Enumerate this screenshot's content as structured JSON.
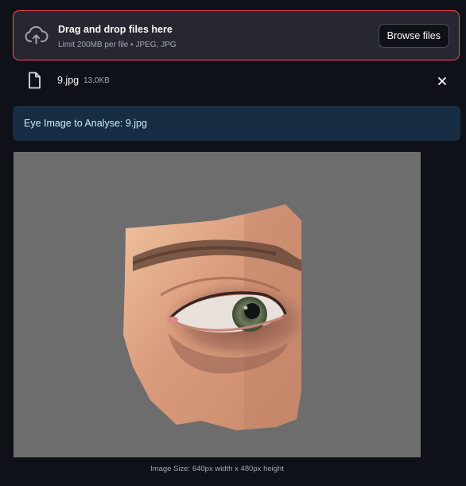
{
  "uploader": {
    "title": "Drag and drop files here",
    "limit": "Limit 200MB per file • JPEG, JPG",
    "browse_label": "Browse files",
    "icon": "cloud-upload-icon",
    "accent_color": "#ff4b4b"
  },
  "file": {
    "name": "9.jpg",
    "size": "13.0KB",
    "icon": "file-icon",
    "remove_icon": "close-icon"
  },
  "info": {
    "message": "Eye Image to Analyse: 9.jpg"
  },
  "image": {
    "caption": "Image Size: 640px width x 480px height"
  }
}
